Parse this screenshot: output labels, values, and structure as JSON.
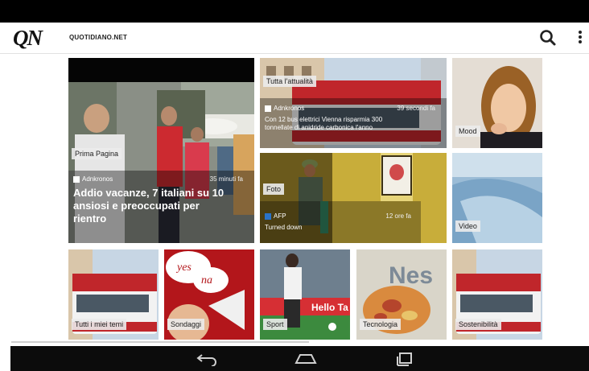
{
  "app": {
    "logo": "QN",
    "site": "QUOTIDIANO.NET"
  },
  "toolbar": {
    "search_icon": "search-icon",
    "menu_icon": "overflow-menu-icon"
  },
  "tiles": {
    "prima": {
      "label": "Prima Pagina",
      "source": "Adnkronos",
      "time": "35 minuti fa",
      "headline": "Addio vacanze, 7 italiani su 10 ansiosi e preoccupati per rientro"
    },
    "attualita": {
      "label": "Tutta l'attualità",
      "source": "Adnkronos",
      "time": "39 secondi fa",
      "text": "Con 12 bus elettrici Vienna risparmia 300 tonnellate di anidride carbonica l'anno"
    },
    "mood": {
      "label": "Mood"
    },
    "foto": {
      "label": "Foto",
      "source": "AFP",
      "time": "12 ore fa",
      "text": "Turned down"
    },
    "video": {
      "label": "Video"
    },
    "temi": {
      "label": "Tutti i miei temi"
    },
    "sondaggi": {
      "label": "Sondaggi",
      "bubble1": "yes",
      "bubble2": "na"
    },
    "sport": {
      "label": "Sport",
      "banner": "Hello Ta"
    },
    "tecnologia": {
      "label": "Tecnologia",
      "brand": "Nes"
    },
    "sostenibilita": {
      "label": "Sostenibilità"
    }
  },
  "colors": {
    "bus_red": "#c0262b",
    "bus_white": "#f2f2f2",
    "sondaggi_red": "#b3161b",
    "foto_bg": "#6b5a1c"
  }
}
